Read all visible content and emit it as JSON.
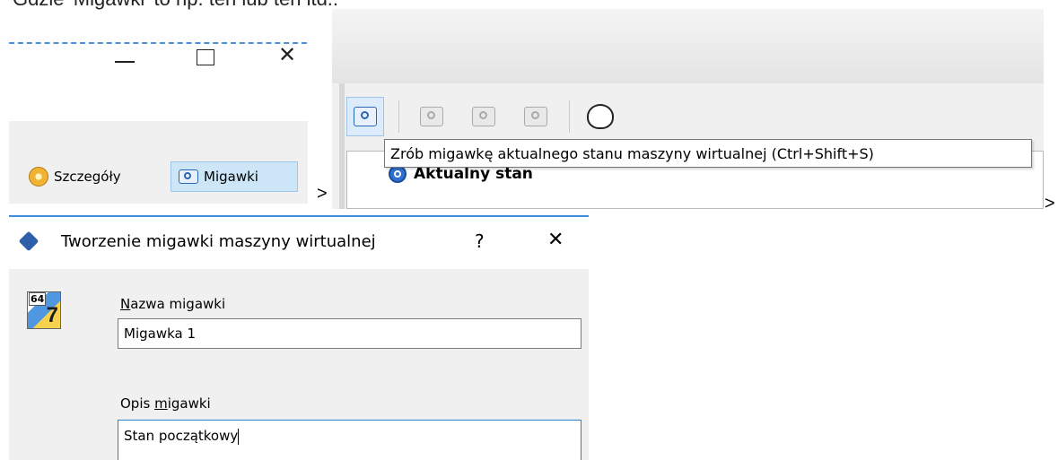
{
  "caption": "Gdzie 'Migawki' to np. ten lub ten itd.:",
  "panel_window": {
    "min_icon": "minimize-icon",
    "max_icon": "maximize-icon",
    "close_glyph": "✕"
  },
  "tabs": {
    "details_label": "Szczegóły",
    "snapshots_label": "Migawki"
  },
  "arrows": {
    "first": ">",
    "second": ">"
  },
  "toolbar": {
    "tooltip": "Zrób migawkę aktualnego stanu maszyny wirtualnej (Ctrl+Shift+S)",
    "current_state": "Aktualny stan"
  },
  "dialog": {
    "title": "Tworzenie migawki maszyny wirtualnej",
    "help": "?",
    "close": "✕",
    "os_badge_num": "64",
    "os_badge_big": "7",
    "name_label_prefix": "N",
    "name_label_rest": "azwa migawki",
    "name_value": "Migawka 1",
    "desc_label_prefix": "Opis ",
    "desc_label_u": "m",
    "desc_label_rest": "igawki",
    "desc_value": "Stan początkowy"
  },
  "colors": {
    "accent": "#3c8fd8",
    "tab_selected_bg": "#cde6f7",
    "tooltip_border": "#767676"
  }
}
